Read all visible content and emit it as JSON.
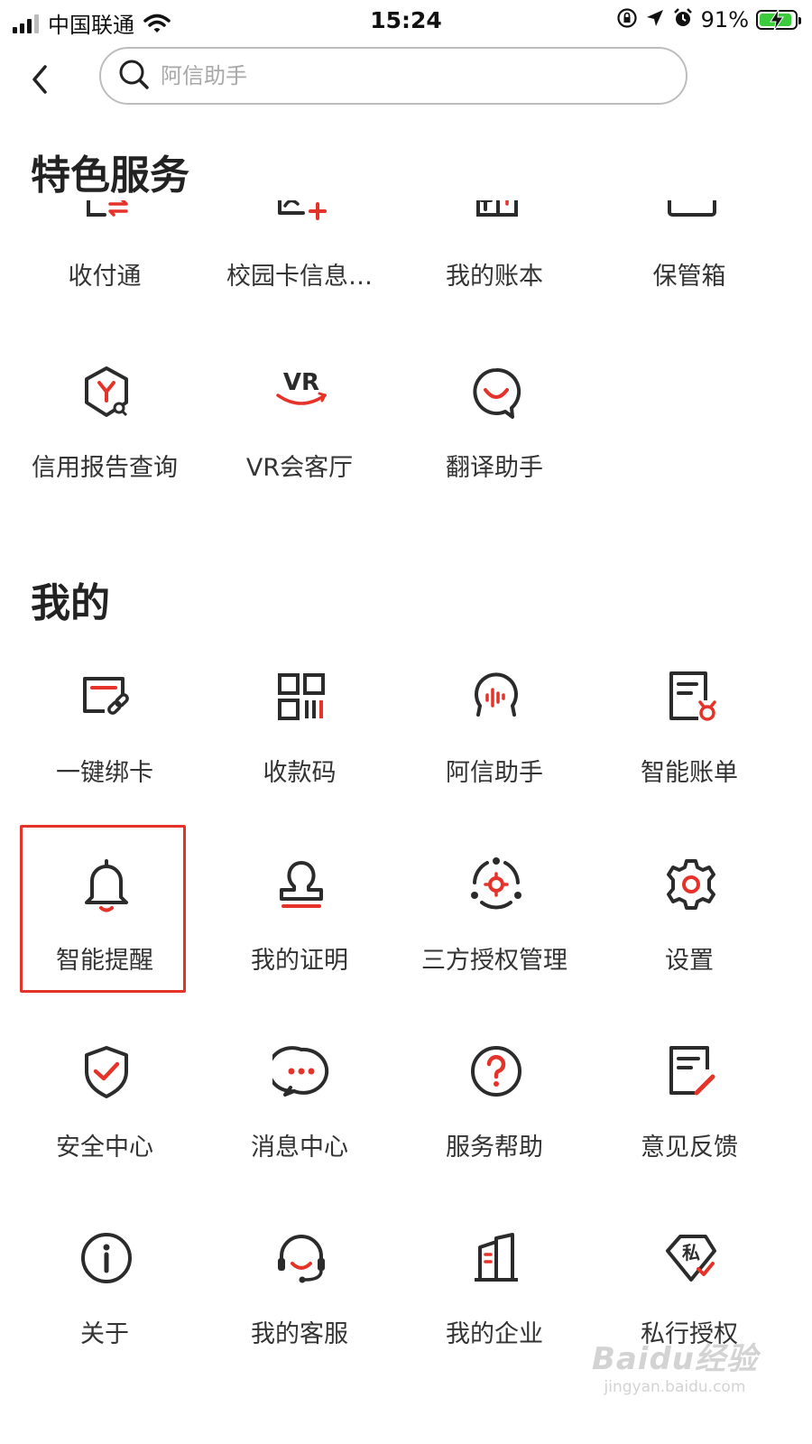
{
  "status_bar": {
    "carrier": "中国联通",
    "time": "15:24",
    "battery": "91%",
    "battery_level": 0.91
  },
  "search": {
    "placeholder": "阿信助手"
  },
  "sections": {
    "featured": {
      "title": "特色服务",
      "items": [
        {
          "label": "收付通",
          "icon": "transfer-icon"
        },
        {
          "label": "校园卡信息…",
          "icon": "campus-card-icon"
        },
        {
          "label": "我的账本",
          "icon": "ledger-icon"
        },
        {
          "label": "保管箱",
          "icon": "safe-box-icon"
        },
        {
          "label": "信用报告查询",
          "icon": "credit-report-icon"
        },
        {
          "label": "VR会客厅",
          "icon": "vr-icon"
        },
        {
          "label": "翻译助手",
          "icon": "translate-icon"
        }
      ]
    },
    "mine": {
      "title": "我的",
      "items": [
        {
          "label": "一键绑卡",
          "icon": "bind-card-icon"
        },
        {
          "label": "收款码",
          "icon": "qr-code-icon"
        },
        {
          "label": "阿信助手",
          "icon": "voice-assistant-icon"
        },
        {
          "label": "智能账单",
          "icon": "smart-bill-icon"
        },
        {
          "label": "智能提醒",
          "icon": "bell-icon"
        },
        {
          "label": "我的证明",
          "icon": "stamp-icon"
        },
        {
          "label": "三方授权管理",
          "icon": "authorization-icon"
        },
        {
          "label": "设置",
          "icon": "gear-icon"
        },
        {
          "label": "安全中心",
          "icon": "shield-icon"
        },
        {
          "label": "消息中心",
          "icon": "message-icon"
        },
        {
          "label": "服务帮助",
          "icon": "help-icon"
        },
        {
          "label": "意见反馈",
          "icon": "feedback-icon"
        },
        {
          "label": "关于",
          "icon": "info-icon"
        },
        {
          "label": "我的客服",
          "icon": "headset-icon"
        },
        {
          "label": "我的企业",
          "icon": "building-icon"
        },
        {
          "label": "私行授权",
          "icon": "private-auth-icon"
        }
      ]
    }
  },
  "watermark": {
    "brand": "Baidu经验",
    "url": "jingyan.baidu.com"
  },
  "colors": {
    "accent": "#e5332a",
    "icon_stroke": "#2b2b2b",
    "battery": "#3ccb3c"
  }
}
